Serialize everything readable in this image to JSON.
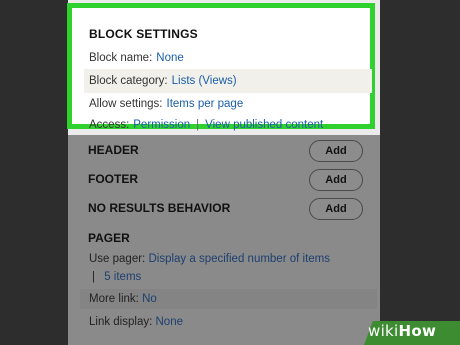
{
  "block_settings": {
    "title": "BLOCK SETTINGS",
    "block_name_label": "Block name:",
    "block_name_value": "None",
    "block_category_label": "Block category:",
    "block_category_value": "Lists (Views)",
    "allow_settings_label": "Allow settings:",
    "allow_settings_value": "Items per page",
    "access_label": "Access:",
    "access_permission": "Permission",
    "access_separator": "|",
    "access_view_published": "View published content"
  },
  "sections": {
    "header_label": "HEADER",
    "header_add": "Add",
    "footer_label": "FOOTER",
    "footer_add": "Add",
    "no_results_label": "NO RESULTS BEHAVIOR",
    "no_results_add": "Add",
    "pager_label": "PAGER"
  },
  "pager": {
    "use_pager_label": "Use pager:",
    "use_pager_value": "Display a specified number of items",
    "separator": "|",
    "items_value": "5 items",
    "more_link_label": "More link:",
    "more_link_value": "No",
    "link_display_label": "Link display:",
    "link_display_value": "None"
  },
  "watermark": {
    "wiki": "wiki",
    "how": "How"
  },
  "colors": {
    "highlight_border": "#2fd12f",
    "link": "#1b5ea8",
    "watermark_bg": "#3d8c32"
  }
}
